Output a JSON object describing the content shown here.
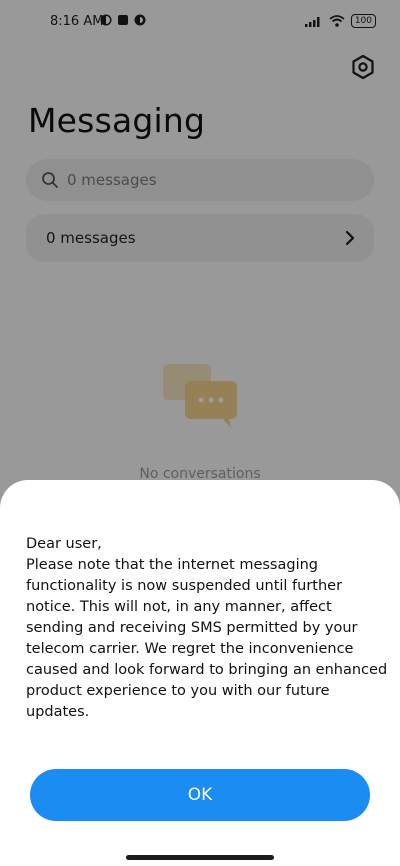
{
  "status_bar": {
    "time": "8:16 AM",
    "battery": "100"
  },
  "screen": {
    "title": "Messaging",
    "search": {
      "placeholder": "0 messages"
    },
    "messages_row": {
      "label": "0 messages"
    },
    "empty_state": {
      "text": "No conversations"
    }
  },
  "dialog": {
    "message": "Dear user,\nPlease note that the internet messaging functionality is now suspended until further notice. This will not, in any manner, affect sending and receiving SMS permitted by your telecom carrier. We regret the inconvenience caused and look forward to bringing an enhanced product experience to you with our future updates.",
    "ok_label": "OK"
  },
  "colors": {
    "accent": "#1a8cf2",
    "scrim": "rgba(0,0,0,0.38)"
  },
  "icons": [
    "gear-icon",
    "search-icon",
    "chevron-right-icon",
    "chat-bubbles-icon",
    "wifi-icon",
    "signal-icon",
    "battery-icon"
  ]
}
